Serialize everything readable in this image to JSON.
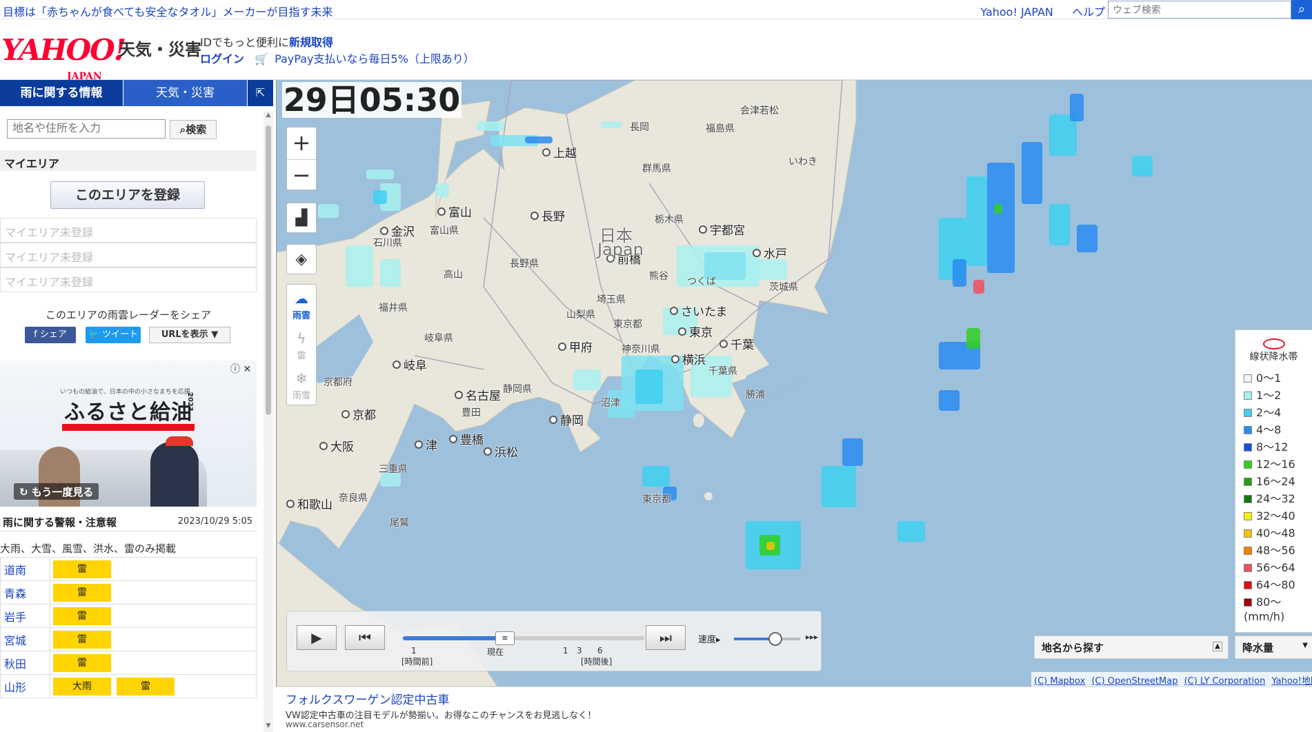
{
  "topbar": {
    "headline": "目標は「赤ちゃんが食べても安全なタオル」メーカーが目指す未来",
    "links": [
      "Yahoo! JAPAN",
      "ヘルプ"
    ],
    "search_placeholder": "ウェブ検索",
    "search_icon": "search-icon"
  },
  "header": {
    "logo": "YAHOO!",
    "logo_sub": "JAPAN",
    "service": "天気・災害",
    "id_text": "IDでもっと便利に",
    "id_link": "新規取得",
    "login": "ログイン",
    "paypay": "PayPay支払いなら毎日5%（上限あり）"
  },
  "sidebar": {
    "tabs": [
      "雨に関する情報",
      "天気・災害"
    ],
    "collapse_icon": "collapse-arrow-icon",
    "place_placeholder": "地名や住所を入力",
    "place_search": "検索",
    "myarea_title": "マイエリア",
    "register_button": "このエリアを登録",
    "myarea_slots": [
      "マイエリア未登録",
      "マイエリア未登録",
      "マイエリア未登録"
    ],
    "share_title": "このエリアの雨雲レーダーをシェア",
    "share_fb": "シェア",
    "share_tw": "ツイート",
    "share_url": "URLを表示 ▼",
    "ad": {
      "small": "いつもの給油で、日本の中の小さなまちを応援。",
      "title": "ふるさと給油",
      "year": "2023",
      "replay": "もう一度見る"
    },
    "warnings": {
      "title": "雨に関する警報・注意報",
      "date": "2023/10/29 5:05",
      "note": "大雨、大雪、風雪、洪水、雷のみ掲載",
      "rows": [
        {
          "pref": "道南",
          "badges": [
            "雷"
          ]
        },
        {
          "pref": "青森",
          "badges": [
            "雷"
          ]
        },
        {
          "pref": "岩手",
          "badges": [
            "雷"
          ]
        },
        {
          "pref": "宮城",
          "badges": [
            "雷"
          ]
        },
        {
          "pref": "秋田",
          "badges": [
            "雷"
          ]
        },
        {
          "pref": "山形",
          "badges": [
            "大雨",
            "雷"
          ]
        }
      ]
    }
  },
  "map": {
    "timestamp": "29日05:30",
    "zoom_in": "+",
    "zoom_out": "−",
    "types": [
      {
        "label": "雨雲",
        "icon": "cloud-rain-icon",
        "active": true
      },
      {
        "label": "雷",
        "icon": "lightning-icon",
        "active": false
      },
      {
        "label": "雨雪",
        "icon": "snow-rain-icon",
        "active": false
      }
    ],
    "center_label_ja": "日本",
    "center_label_en": "Japan",
    "cities": [
      "会津若松",
      "長岡",
      "福島県",
      "上越",
      "いわき",
      "群馬県",
      "富山",
      "長野",
      "宇都宮",
      "金沢",
      "富山県",
      "栃木県",
      "石川県",
      "前橋",
      "水戸",
      "長野県",
      "高山",
      "熊谷",
      "つくば",
      "茨城県",
      "福井県",
      "埼玉県",
      "さいたま",
      "岐阜県",
      "山梨県",
      "東京都",
      "東京",
      "甲府",
      "千葉",
      "神奈川県",
      "横浜",
      "岐阜",
      "京都府",
      "千葉県",
      "静岡県",
      "名古屋",
      "勝浦",
      "沼津",
      "京都",
      "豊田",
      "静岡",
      "豊橋",
      "浜松",
      "津",
      "大阪",
      "三重県",
      "奈良県",
      "和歌山",
      "東京都",
      "尾鷲"
    ],
    "player": {
      "label_1": "1",
      "label_before": "[時間前]",
      "label_now": "現在",
      "label_1a": "1",
      "label_3": "3",
      "label_6": "6",
      "label_after": "[時間後]",
      "speed": "速度"
    },
    "legend": {
      "title": "線状降水帯",
      "items": [
        {
          "label": "0〜1",
          "color": "#f2f2ff"
        },
        {
          "label": "1〜2",
          "color": "#a8f0f0"
        },
        {
          "label": "2〜4",
          "color": "#40d0f0"
        },
        {
          "label": "4〜8",
          "color": "#2a8cf0"
        },
        {
          "label": "8〜12",
          "color": "#1a4ce0"
        },
        {
          "label": "12〜16",
          "color": "#30d020"
        },
        {
          "label": "16〜24",
          "color": "#22a010"
        },
        {
          "label": "24〜32",
          "color": "#127a10"
        },
        {
          "label": "32〜40",
          "color": "#f8f000"
        },
        {
          "label": "40〜48",
          "color": "#f8c000"
        },
        {
          "label": "48〜56",
          "color": "#f08000"
        },
        {
          "label": "56〜64",
          "color": "#f05060"
        },
        {
          "label": "64〜80",
          "color": "#e01010"
        },
        {
          "label": "80〜",
          "color": "#a00010"
        }
      ],
      "unit": "(mm/h)"
    },
    "place_panel": "地名から探す",
    "precip_panel": "降水量",
    "attribution": [
      "(C) Mapbox",
      "(C) OpenStreetMap",
      "(C) LY Corporation",
      "Yahoo!地図ガイドライン"
    ]
  },
  "bottom_ad": {
    "title": "フォルクスワーゲン認定中古車",
    "desc": "VW認定中古車の注目モデルが勢揃い。お得なこのチャンスをお見逃しなく！",
    "url": "www.carsensor.net"
  }
}
